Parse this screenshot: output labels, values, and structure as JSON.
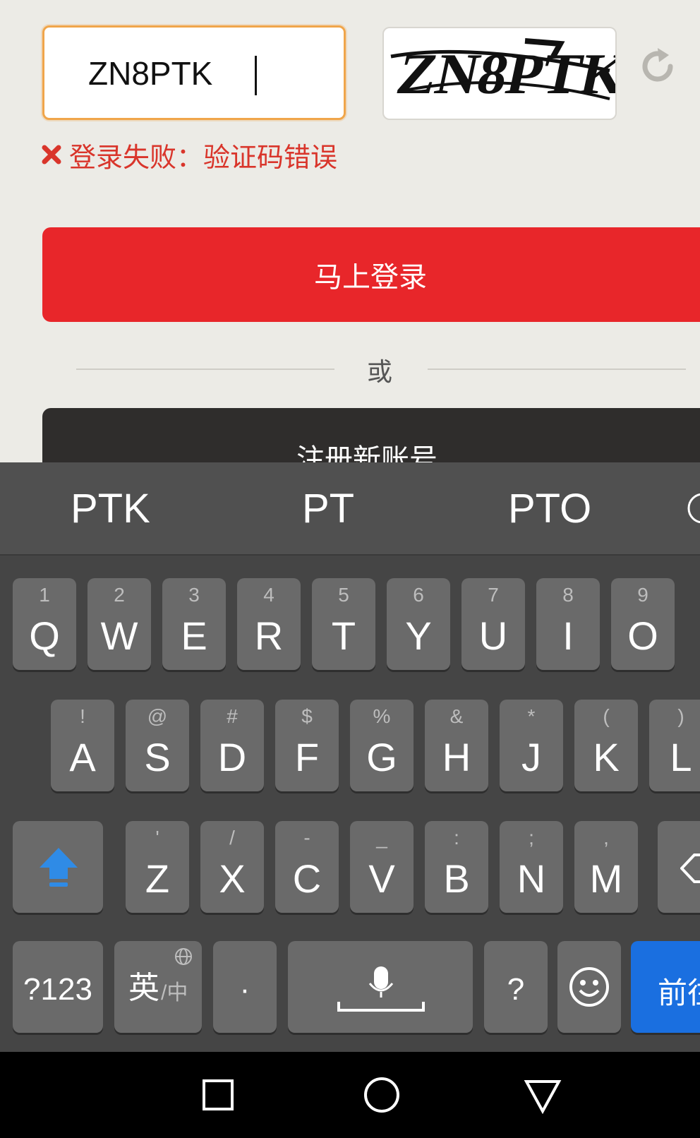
{
  "form": {
    "captcha_value": "ZN8PTK",
    "captcha_image_text": "ZN8PTK",
    "error_message": "登录失败：验证码错误",
    "login_label": "马上登录",
    "divider_label": "或",
    "register_label": "注册新账号"
  },
  "keyboard": {
    "suggestions": [
      "PTK",
      "PT",
      "PTO"
    ],
    "row1": [
      {
        "main": "Q",
        "sub": "1"
      },
      {
        "main": "W",
        "sub": "2"
      },
      {
        "main": "E",
        "sub": "3"
      },
      {
        "main": "R",
        "sub": "4"
      },
      {
        "main": "T",
        "sub": "5"
      },
      {
        "main": "Y",
        "sub": "6"
      },
      {
        "main": "U",
        "sub": "7"
      },
      {
        "main": "I",
        "sub": "8"
      },
      {
        "main": "O",
        "sub": "9"
      }
    ],
    "row2": [
      {
        "main": "A",
        "sub": "!"
      },
      {
        "main": "S",
        "sub": "@"
      },
      {
        "main": "D",
        "sub": "#"
      },
      {
        "main": "F",
        "sub": "$"
      },
      {
        "main": "G",
        "sub": "%"
      },
      {
        "main": "H",
        "sub": "&"
      },
      {
        "main": "J",
        "sub": "*"
      },
      {
        "main": "K",
        "sub": "("
      },
      {
        "main": "L",
        "sub": ")"
      }
    ],
    "row3": [
      {
        "main": "Z",
        "sub": "'"
      },
      {
        "main": "X",
        "sub": "/"
      },
      {
        "main": "C",
        "sub": "-"
      },
      {
        "main": "V",
        "sub": "_"
      },
      {
        "main": "B",
        "sub": ":"
      },
      {
        "main": "N",
        "sub": ";"
      },
      {
        "main": "M",
        "sub": ","
      }
    ],
    "numbers_label": "?123",
    "lang_label_main": "英",
    "lang_label_sub": "/中",
    "dot_label": "·",
    "question_label": "?",
    "enter_label": "前往"
  },
  "colors": {
    "error_red": "#d9352b",
    "login_red": "#e8262a",
    "input_border": "#f0a54a",
    "shift_blue": "#2f8be6",
    "enter_blue": "#1a6fe0"
  }
}
